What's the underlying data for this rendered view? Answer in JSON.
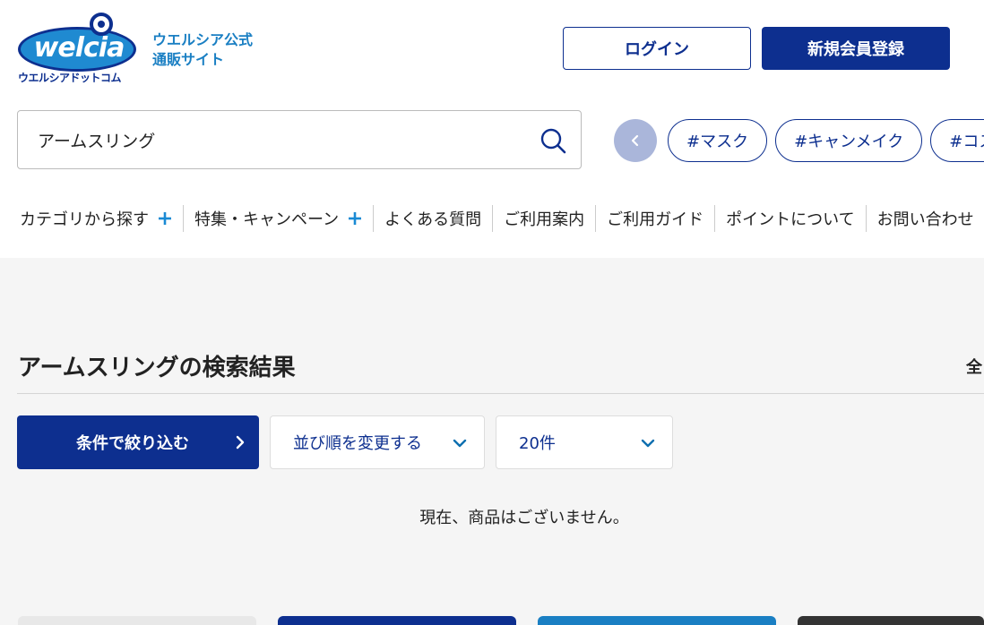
{
  "header": {
    "logo_word": "welcia",
    "logo_sub": "ウエルシアドットコム",
    "site_name_line1": "ウエルシア公式",
    "site_name_line2": "通販サイト",
    "login_label": "ログイン",
    "register_label": "新規会員登録"
  },
  "search": {
    "value": "アームスリング",
    "icon": "search-icon"
  },
  "tags": [
    "#マスク",
    "#キャンメイク",
    "#コスメ"
  ],
  "nav": {
    "items": [
      {
        "label": "カテゴリから探す",
        "expandable": true
      },
      {
        "label": "特集・キャンペーン",
        "expandable": true
      },
      {
        "label": "よくある質問",
        "expandable": false
      },
      {
        "label": "ご利用案内",
        "expandable": false
      },
      {
        "label": "ご利用ガイド",
        "expandable": false
      },
      {
        "label": "ポイントについて",
        "expandable": false
      },
      {
        "label": "お問い合わせ",
        "expandable": false
      }
    ]
  },
  "results": {
    "title": "アームスリングの検索結果",
    "count_label": "全",
    "filter_label": "条件で絞り込む",
    "sort_label": "並び順を変更する",
    "per_page_label": "20件",
    "empty_message": "現在、商品はございません。"
  },
  "colors": {
    "brand_navy": "#0d2f8f",
    "brand_blue": "#1a7fc3",
    "plus_blue": "#1a8ad4",
    "prev_button": "#aab6da",
    "background": "#f5f5f5"
  }
}
